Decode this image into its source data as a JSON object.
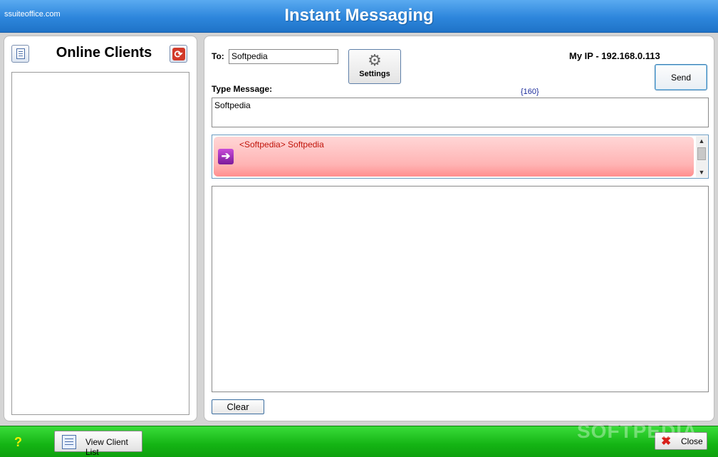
{
  "titlebar": {
    "site": "ssuiteoffice.com",
    "title": "Instant Messaging"
  },
  "left": {
    "heading": "Online Clients"
  },
  "compose": {
    "to_label": "To:",
    "to_value": "Softpedia",
    "settings_label": "Settings",
    "my_ip": "My IP - 192.168.0.113",
    "send_label": "Send",
    "type_label": "Type Message:",
    "char_count": "{160}",
    "message": "Softpedia"
  },
  "chat": {
    "latest": "<Softpedia> Softpedia"
  },
  "clear_label": "Clear",
  "bottom": {
    "help": "?",
    "view_client_list": "View Client List",
    "close": "Close",
    "watermark": "SOFTPEDIA"
  }
}
